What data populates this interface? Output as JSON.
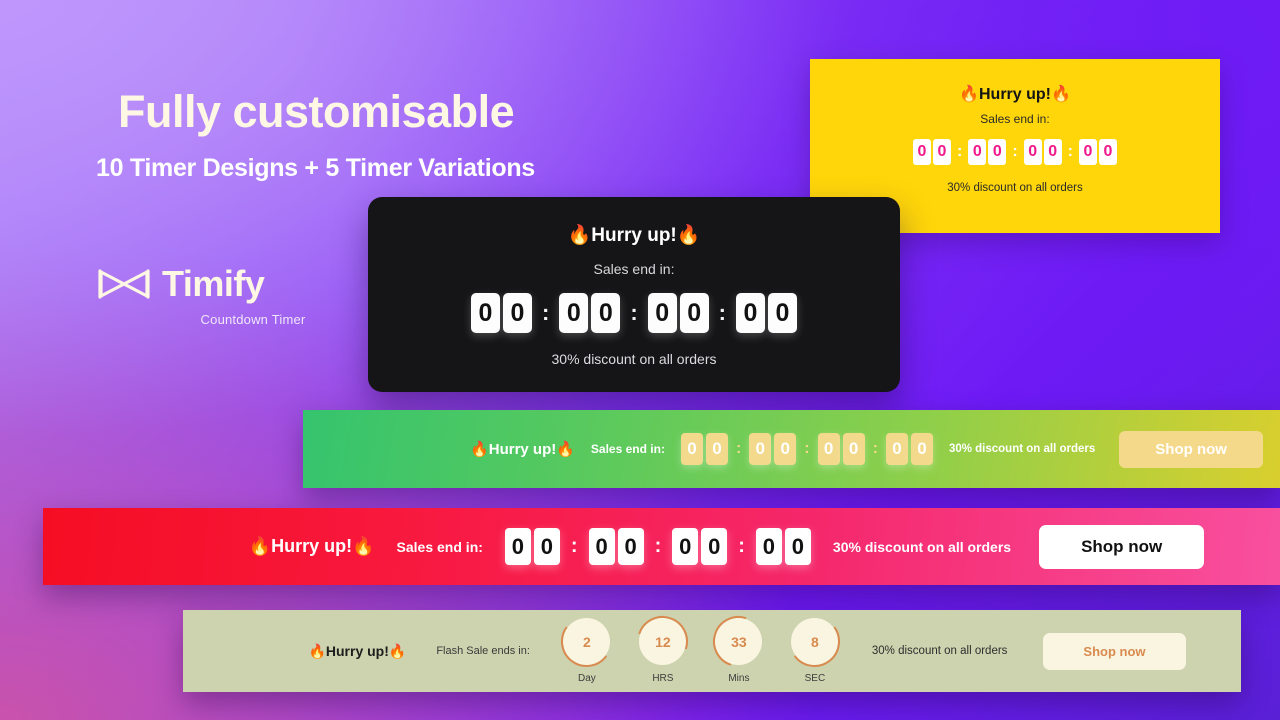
{
  "background": {
    "gradient_start": "#b48cf8",
    "gradient_mid": "#8b45f3",
    "gradient_end": "#5a20d6",
    "accent_purple": "#6e1bf5",
    "accent_magenta": "#c952ac"
  },
  "headline": {
    "title": "Fully customisable",
    "subtitle": "10 Timer Designs + 5 Timer Variations"
  },
  "logo": {
    "icon": "hourglass-icon",
    "wordmark": "Timify",
    "tagline": "Countdown Timer"
  },
  "timers": {
    "yellow_card": {
      "style": "card",
      "background": "#FFD60A",
      "hurry_text": "Hurry up!",
      "flame_left": "🔥",
      "flame_right": "🔥",
      "subtitle": "Sales end in:",
      "digits": [
        "0",
        "0",
        "0",
        "0",
        "0",
        "0",
        "0",
        "0"
      ],
      "separator": ":",
      "digit_color": "#F0198C",
      "tile_color": "#ffffff",
      "footer": "30% discount on all orders"
    },
    "dark_card": {
      "style": "card",
      "background": "#151517",
      "hurry_text": "Hurry up!",
      "flame_left": "🔥",
      "flame_right": "🔥",
      "subtitle": "Sales end in:",
      "digits": [
        "0",
        "0",
        "0",
        "0",
        "0",
        "0",
        "0",
        "0"
      ],
      "separator": ":",
      "digit_color": "#111111",
      "tile_color": "#fdfdfd",
      "footer": "30% discount on all orders"
    },
    "green_bar": {
      "style": "bar",
      "gradient_start": "#35c46e",
      "gradient_end": "#d9cf2e",
      "hurry_text": "Hurry up!",
      "flame_left": "🔥",
      "flame_right": "🔥",
      "subtitle": "Sales end in:",
      "digits": [
        "0",
        "0",
        "0",
        "0",
        "0",
        "0",
        "0",
        "0"
      ],
      "separator": ":",
      "digit_color": "#ffffff",
      "tile_color": "#f2d98b",
      "footer": "30% discount on all orders",
      "cta_label": "Shop now"
    },
    "red_bar": {
      "style": "bar",
      "gradient_start": "#f50d23",
      "gradient_end": "#f8509f",
      "hurry_text": "Hurry up!",
      "flame_left": "🔥",
      "flame_right": "🔥",
      "subtitle": "Sales end in:",
      "digits": [
        "0",
        "0",
        "0",
        "0",
        "0",
        "0",
        "0",
        "0"
      ],
      "separator": ":",
      "digit_color": "#111111",
      "tile_color": "#ffffff",
      "footer": "30% discount on all orders",
      "cta_label": "Shop now"
    },
    "sage_bar": {
      "style": "bar",
      "background": "#ccd3ae",
      "hurry_text": "Hurry up!",
      "flame_left": "🔥",
      "flame_right": "🔥",
      "subtitle": "Flash Sale ends in:",
      "units": [
        {
          "value": "2",
          "label": "Day",
          "progress": 35
        },
        {
          "value": "12",
          "label": "HRS",
          "progress": 80
        },
        {
          "value": "33",
          "label": "Mins",
          "progress": 55
        },
        {
          "value": "8",
          "label": "SEC",
          "progress": 15
        }
      ],
      "accent_color": "#d98a4e",
      "circle_fill": "#faf5e1",
      "footer": "30% discount on all orders",
      "cta_label": "Shop now"
    }
  }
}
